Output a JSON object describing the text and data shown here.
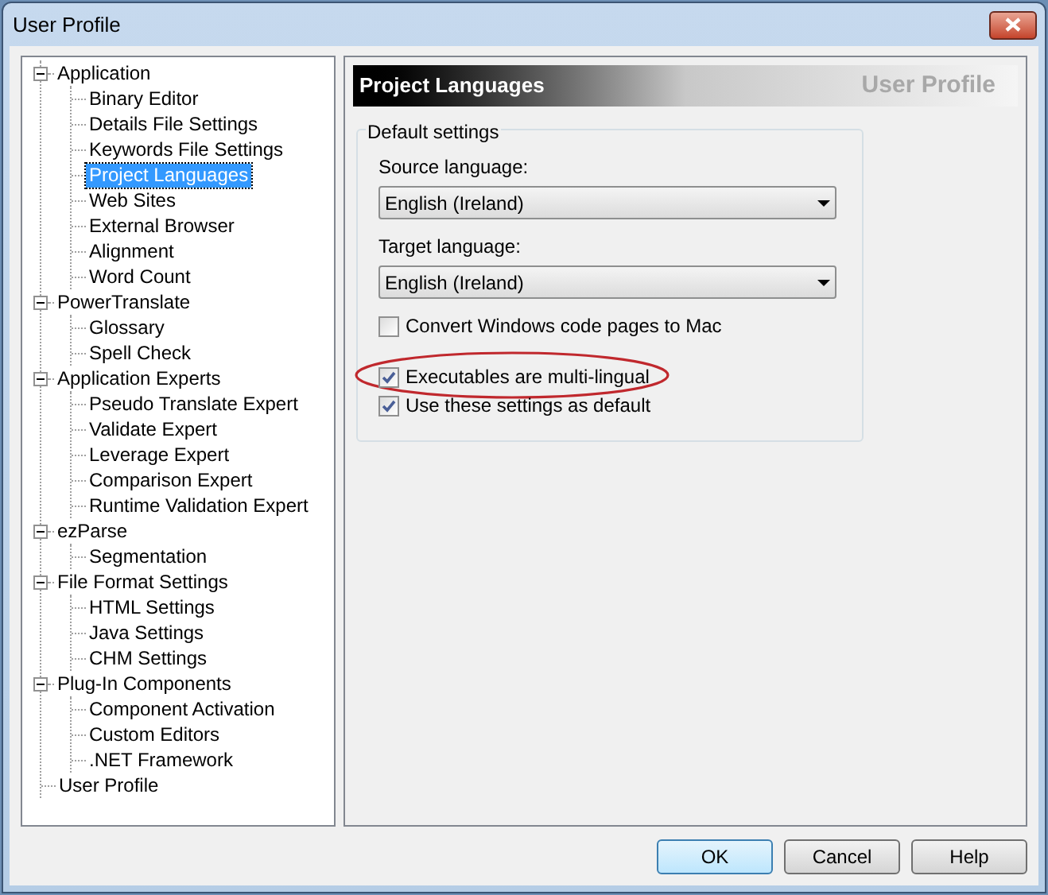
{
  "window": {
    "title": "User Profile"
  },
  "tree": [
    {
      "label": "Application",
      "expanded": true,
      "selected": false,
      "children": [
        {
          "label": "Binary Editor",
          "selected": false
        },
        {
          "label": "Details File Settings",
          "selected": false
        },
        {
          "label": "Keywords File Settings",
          "selected": false
        },
        {
          "label": "Project Languages",
          "selected": true
        },
        {
          "label": "Web Sites",
          "selected": false
        },
        {
          "label": "External Browser",
          "selected": false
        },
        {
          "label": "Alignment",
          "selected": false
        },
        {
          "label": "Word Count",
          "selected": false
        }
      ]
    },
    {
      "label": "PowerTranslate",
      "expanded": true,
      "selected": false,
      "children": [
        {
          "label": "Glossary",
          "selected": false
        },
        {
          "label": "Spell Check",
          "selected": false
        }
      ]
    },
    {
      "label": "Application Experts",
      "expanded": true,
      "selected": false,
      "children": [
        {
          "label": "Pseudo Translate Expert",
          "selected": false
        },
        {
          "label": "Validate Expert",
          "selected": false
        },
        {
          "label": "Leverage Expert",
          "selected": false
        },
        {
          "label": "Comparison Expert",
          "selected": false
        },
        {
          "label": "Runtime Validation Expert",
          "selected": false
        }
      ]
    },
    {
      "label": "ezParse",
      "expanded": true,
      "selected": false,
      "children": [
        {
          "label": "Segmentation",
          "selected": false
        }
      ]
    },
    {
      "label": "File Format Settings",
      "expanded": true,
      "selected": false,
      "children": [
        {
          "label": "HTML Settings",
          "selected": false
        },
        {
          "label": "Java Settings",
          "selected": false
        },
        {
          "label": "CHM Settings",
          "selected": false
        }
      ]
    },
    {
      "label": "Plug-In Components",
      "expanded": true,
      "selected": false,
      "children": [
        {
          "label": "Component Activation",
          "selected": false
        },
        {
          "label": "Custom Editors",
          "selected": false
        },
        {
          "label": ".NET Framework",
          "selected": false
        }
      ]
    },
    {
      "label": "User Profile",
      "selected": false
    }
  ],
  "panel": {
    "heading": "Project Languages",
    "subtitle": "User Profile",
    "group": {
      "title": "Default settings",
      "fields": [
        {
          "label": "Source language:",
          "value": "English (Ireland)"
        },
        {
          "label": "Target language:",
          "value": "English (Ireland)"
        }
      ],
      "checkboxes": [
        {
          "label": "Convert Windows code pages to Mac",
          "checked": false,
          "highlighted": false
        },
        {
          "label": "Executables are multi-lingual",
          "checked": true,
          "highlighted": true
        },
        {
          "label": "Use these settings as default",
          "checked": true,
          "highlighted": false
        }
      ]
    }
  },
  "buttons": [
    {
      "label": "OK",
      "default": true
    },
    {
      "label": "Cancel",
      "default": false
    },
    {
      "label": "Help",
      "default": false
    }
  ]
}
